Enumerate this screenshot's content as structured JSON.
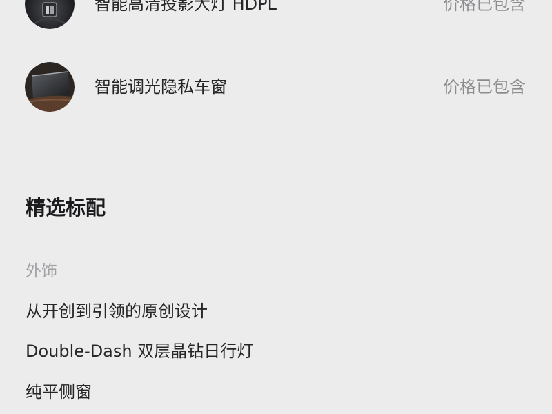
{
  "options": [
    {
      "name": "智能高清投影大灯 HDPL",
      "status": "价格已包含",
      "icon": "headlight-thumbnail"
    },
    {
      "name": "智能调光隐私车窗",
      "status": "价格已包含",
      "icon": "privacy-window-thumbnail"
    }
  ],
  "standard_features": {
    "title": "精选标配",
    "category": "外饰",
    "items": [
      "从开创到引领的原创设计",
      "Double-Dash 双层晶钻日行灯",
      "纯平侧窗"
    ]
  },
  "colors": {
    "background": "#ececed",
    "primary_text": "#262628",
    "secondary_text": "#8c8c8f",
    "category_text": "#a1a1a4"
  }
}
